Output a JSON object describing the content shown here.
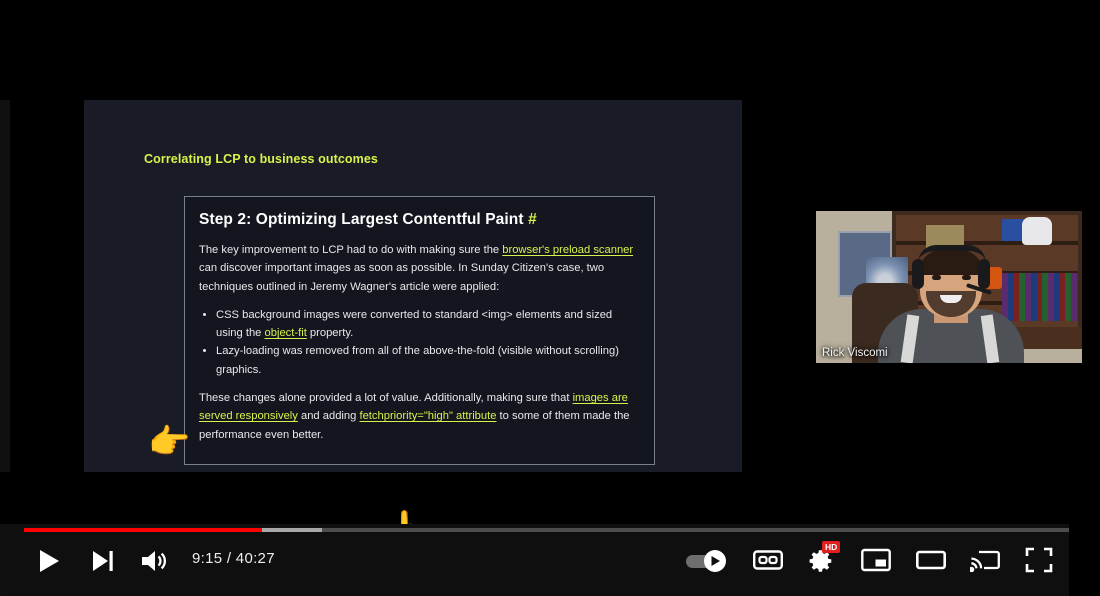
{
  "slide": {
    "header": "Correlating LCP to business outcomes",
    "card": {
      "heading": "Step 2: Optimizing Largest Contentful Paint",
      "heading_anchor": "#",
      "paragraph1_part1": "The key improvement to LCP had to do with making sure the ",
      "paragraph1_link1": "browser's preload scanner",
      "paragraph1_part2": " can discover important images as soon as possible. In Sunday Citizen's case, two techniques outlined in Jeremy Wagner's article were applied:",
      "bullets": [
        {
          "part1": "CSS background images were converted to standard <img> elements and sized using the ",
          "link": "object-fit",
          "part2": " property."
        },
        {
          "part1": "Lazy-loading was removed from all of the above-the-fold (visible without scrolling) graphics.",
          "link": "",
          "part2": ""
        }
      ],
      "paragraph2_part1": "These changes alone provided a lot of value. Additionally, making sure that ",
      "paragraph2_link1": "images are served responsively",
      "paragraph2_part2": " and adding ",
      "paragraph2_link2": "fetchpriority=\"high\" attribute",
      "paragraph2_part3": " to some of them made the performance even better."
    },
    "pointer_right": "👉",
    "pointer_up": "👆"
  },
  "webcam": {
    "speaker_name": "Rick Viscomi"
  },
  "player": {
    "current_time": "9:15",
    "separator": " / ",
    "duration": "40:27",
    "time_display": "9:15 / 40:27",
    "progress_percent": 22.8,
    "buffered_percent": 28.5,
    "quality_badge": "HD",
    "colors": {
      "progress_played": "#ff0000",
      "progress_buffered": "#a8a8a8",
      "progress_track": "#4d4d4d",
      "badge": "#e01f1f"
    },
    "controls": [
      {
        "name": "play",
        "label": "Play"
      },
      {
        "name": "next",
        "label": "Next video"
      },
      {
        "name": "volume",
        "label": "Mute"
      },
      {
        "name": "autoplay",
        "label": "Autoplay is on",
        "state": "on"
      },
      {
        "name": "subtitles",
        "label": "Subtitles/closed captions"
      },
      {
        "name": "settings",
        "label": "Settings"
      },
      {
        "name": "miniplayer",
        "label": "Miniplayer"
      },
      {
        "name": "theater",
        "label": "Theater mode"
      },
      {
        "name": "cast",
        "label": "Play on TV"
      },
      {
        "name": "fullscreen",
        "label": "Full screen"
      }
    ]
  }
}
